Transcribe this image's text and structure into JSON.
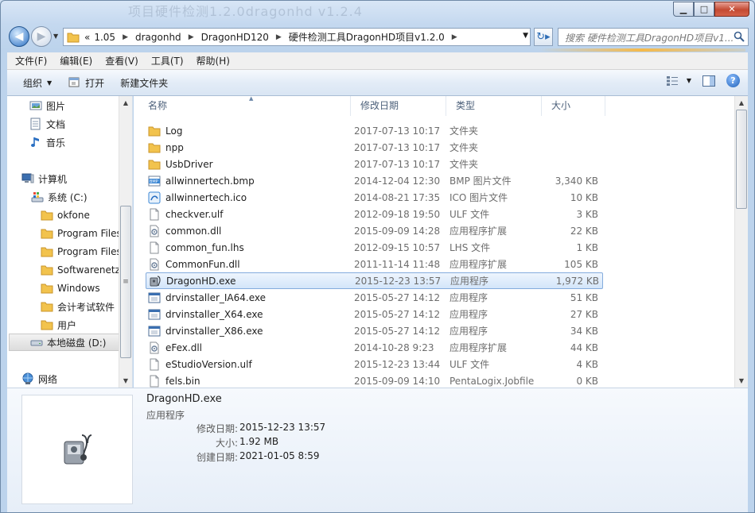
{
  "window": {
    "title": "项目硬件检测1.2.0dragonhd v1.2.4",
    "minimize": "▁",
    "maximize": "□",
    "close": "✕"
  },
  "nav": {
    "back": "◀",
    "forward": "▶",
    "recent": "▼",
    "overflow": "«",
    "breadcrumb": [
      "1.05",
      "dragonhd",
      "DragonHD120",
      "硬件检测工具DragonHD项目v1.2.0"
    ],
    "separator": "▶",
    "address_dropdown": "▼",
    "refresh": "↻▸",
    "search_placeholder": "搜索 硬件检测工具DragonHD项目v1..."
  },
  "menubar": {
    "items": [
      "文件(F)",
      "编辑(E)",
      "查看(V)",
      "工具(T)",
      "帮助(H)"
    ]
  },
  "toolbar": {
    "organize": "组织",
    "organize_caret": "▼",
    "open": "打开",
    "new_folder": "新建文件夹",
    "views_caret": "▼",
    "help": "?"
  },
  "sidebar": {
    "scroll_up": "▲",
    "scroll_down": "▼",
    "grip": "≡",
    "items": [
      {
        "label": "图片",
        "icon": "pictures-icon"
      },
      {
        "label": "文档",
        "icon": "documents-icon"
      },
      {
        "label": "音乐",
        "icon": "music-icon"
      },
      {
        "label": "计算机",
        "icon": "computer-icon"
      },
      {
        "label": "系统 (C:)",
        "icon": "system-drive-icon"
      },
      {
        "label": "okfone",
        "icon": "folder-icon"
      },
      {
        "label": "Program Files",
        "icon": "folder-icon"
      },
      {
        "label": "Program Files",
        "icon": "folder-icon"
      },
      {
        "label": "Softwarenetz",
        "icon": "folder-icon"
      },
      {
        "label": "Windows",
        "icon": "folder-icon"
      },
      {
        "label": "会计考试软件",
        "icon": "folder-icon"
      },
      {
        "label": "用户",
        "icon": "folder-icon"
      },
      {
        "label": "本地磁盘 (D:)",
        "icon": "drive-icon"
      },
      {
        "label": "网络",
        "icon": "network-icon"
      }
    ]
  },
  "columns": {
    "name": "名称",
    "date": "修改日期",
    "type": "类型",
    "size": "大小",
    "sort_indicator": "▲"
  },
  "files": [
    {
      "name": "Log",
      "date": "2017-07-13 10:17",
      "type": "文件夹",
      "size": "",
      "icon": "folder"
    },
    {
      "name": "npp",
      "date": "2017-07-13 10:17",
      "type": "文件夹",
      "size": "",
      "icon": "folder"
    },
    {
      "name": "UsbDriver",
      "date": "2017-07-13 10:17",
      "type": "文件夹",
      "size": "",
      "icon": "folder"
    },
    {
      "name": "allwinnertech.bmp",
      "date": "2014-12-04 12:30",
      "type": "BMP 图片文件",
      "size": "3,340 KB",
      "icon": "bmp"
    },
    {
      "name": "allwinnertech.ico",
      "date": "2014-08-21 17:35",
      "type": "ICO 图片文件",
      "size": "10 KB",
      "icon": "ico"
    },
    {
      "name": "checkver.ulf",
      "date": "2012-09-18 19:50",
      "type": "ULF 文件",
      "size": "3 KB",
      "icon": "file"
    },
    {
      "name": "common.dll",
      "date": "2015-09-09 14:28",
      "type": "应用程序扩展",
      "size": "22 KB",
      "icon": "dll"
    },
    {
      "name": "common_fun.lhs",
      "date": "2012-09-15 10:57",
      "type": "LHS 文件",
      "size": "1 KB",
      "icon": "file"
    },
    {
      "name": "CommonFun.dll",
      "date": "2011-11-14 11:48",
      "type": "应用程序扩展",
      "size": "105 KB",
      "icon": "dll"
    },
    {
      "name": "DragonHD.exe",
      "date": "2015-12-23 13:57",
      "type": "应用程序",
      "size": "1,972 KB",
      "icon": "app"
    },
    {
      "name": "drvinstaller_IA64.exe",
      "date": "2015-05-27 14:12",
      "type": "应用程序",
      "size": "51 KB",
      "icon": "exe"
    },
    {
      "name": "drvinstaller_X64.exe",
      "date": "2015-05-27 14:12",
      "type": "应用程序",
      "size": "27 KB",
      "icon": "exe"
    },
    {
      "name": "drvinstaller_X86.exe",
      "date": "2015-05-27 14:12",
      "type": "应用程序",
      "size": "34 KB",
      "icon": "exe"
    },
    {
      "name": "eFex.dll",
      "date": "2014-10-28 9:23",
      "type": "应用程序扩展",
      "size": "44 KB",
      "icon": "dll"
    },
    {
      "name": "eStudioVersion.ulf",
      "date": "2015-12-23 13:44",
      "type": "ULF 文件",
      "size": "4 KB",
      "icon": "file"
    },
    {
      "name": "fels.bin",
      "date": "2015-09-09 14:10",
      "type": "PentaLogix.Jobfile",
      "size": "0 KB",
      "icon": "file"
    }
  ],
  "selected_index": 9,
  "details": {
    "name": "DragonHD.exe",
    "type": "应用程序",
    "modified_label": "修改日期:",
    "modified": "2015-12-23 13:57",
    "size_label": "大小:",
    "size": "1.92 MB",
    "created_label": "创建日期:",
    "created": "2021-01-05 8:59"
  },
  "colors": {
    "folder": "#f2c34d",
    "selection_border": "#84acdd",
    "accent_blue": "#2a6fc2",
    "close_red": "#c44a32"
  }
}
